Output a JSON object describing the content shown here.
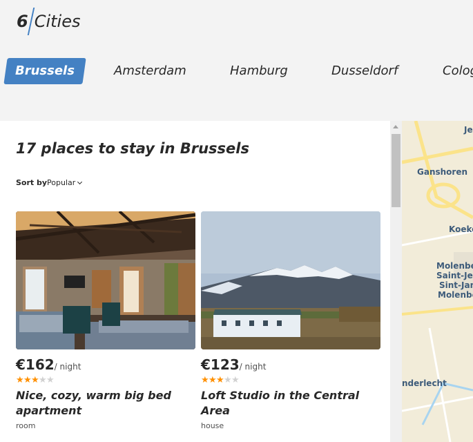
{
  "logo": {
    "number": "6",
    "word": "Cities"
  },
  "tabs": [
    "Brussels",
    "Amsterdam",
    "Hamburg",
    "Dusseldorf",
    "Colog"
  ],
  "title": "17 places to stay in Brussels",
  "sort": {
    "label": "Sort by",
    "value": "Popular"
  },
  "offers": [
    {
      "price": "€162",
      "per": "/ night",
      "rating": 3,
      "name": "Nice, cozy, warm big bed apartment",
      "type": "room"
    },
    {
      "price": "€123",
      "per": "/ night",
      "rating": 3,
      "name": "Loft Studio in the Central Area",
      "type": "house"
    }
  ],
  "map": {
    "labels": [
      "Je",
      "Ganshoren",
      "Koeke",
      "Molenbe",
      "Saint-Je",
      "Sint-Jan",
      "Molenbe",
      "nderlecht"
    ]
  },
  "colors": {
    "accent": "#4481c3",
    "star": "#ff9000"
  },
  "icons": {
    "star": "star-icon",
    "sort_arrow": "chevron-down-icon"
  }
}
